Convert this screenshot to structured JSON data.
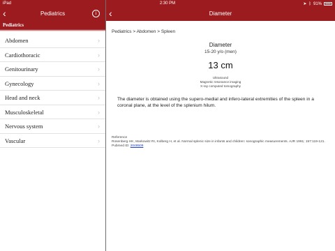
{
  "status_bar": {
    "carrier": "iPad",
    "time": "2:30 PM",
    "battery": "91%",
    "location_icon": "location-arrow-icon",
    "bluetooth_icon": "bluetooth-icon"
  },
  "left_nav": {
    "title": "Pediatrics",
    "back_icon": "chevron-left-icon",
    "info_icon": "info-icon",
    "section": "Pediatrics",
    "items": [
      {
        "label": "Abdomen"
      },
      {
        "label": "Cardiothoracic"
      },
      {
        "label": "Genitourinary"
      },
      {
        "label": "Gynecology"
      },
      {
        "label": "Head and neck"
      },
      {
        "label": "Musculoskeletal"
      },
      {
        "label": "Nervous system"
      },
      {
        "label": "Vascular"
      }
    ]
  },
  "right_nav": {
    "title": "Diameter",
    "back_icon": "chevron-left-icon"
  },
  "detail": {
    "breadcrumb": "Pediatrics > Abdomen > Spleen",
    "title": "Diameter",
    "subtitle": "15-20 y/o (men)",
    "value": "13 cm",
    "methods": [
      "Ultrasound",
      "Magnetic resonance imaging",
      "X-ray computed tomography"
    ],
    "description": "The diameter is obtained using the supero-medial and infero-lateral extremities of the spleen in a coronal plane, at the level of the splenium hilum.",
    "reference_label": "Reference",
    "reference_text": "Rosenberg HK, Markowitz RI, Kolberg H, et al. Normal splenic size in infants and children: sonographic measurements. AJR 1991; 157:119-121.",
    "pubmed_label": "Pubmed ID:",
    "pubmed_id": "2048509"
  },
  "colors": {
    "accent": "#9b1b1e",
    "link": "#1a3ccf"
  }
}
